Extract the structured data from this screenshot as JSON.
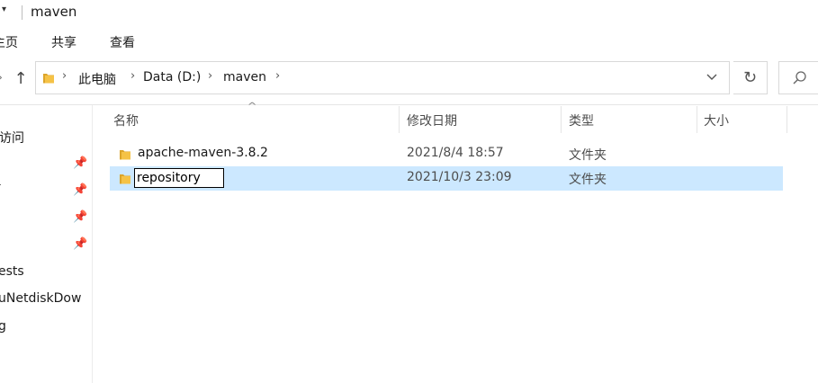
{
  "window": {
    "title": "maven",
    "quick_access_dropdown": "▾"
  },
  "ribbon": {
    "tabs": [
      "主页",
      "共享",
      "查看"
    ]
  },
  "address": {
    "breadcrumbs": [
      "此电脑",
      "Data (D:)",
      "maven"
    ],
    "separator": "›"
  },
  "nav_pane": {
    "items": [
      "访问",
      "ests",
      "uNetdiskDow",
      "g"
    ]
  },
  "columns": {
    "name": "名称",
    "modified": "修改日期",
    "type": "类型",
    "size": "大小"
  },
  "files": [
    {
      "name": "apache-maven-3.8.2",
      "modified": "2021/8/4 18:57",
      "type": "文件夹",
      "selected": false
    },
    {
      "name": "repository",
      "modified": "2021/10/3 23:09",
      "type": "文件夹",
      "selected": true,
      "renaming": true
    }
  ],
  "colors": {
    "selection": "#cce8ff",
    "folder_yellow": "#f5c246",
    "folder_dark": "#dca52b"
  }
}
